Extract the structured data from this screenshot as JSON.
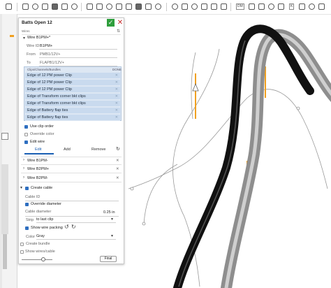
{
  "dialog": {
    "title": "Batts Open 12",
    "section_label": "Wires",
    "wire_group": "Wire B1PM+*",
    "wire_id_label": "Wire ID",
    "wire_id_value": "B1PM+",
    "from_label": "From",
    "from_value": "PMB1/12V+",
    "to_label": "To",
    "to_value": "FLAPB1/12V+",
    "clips_header": "Clips/Channels/Bundles",
    "clips_done": "DONE",
    "clips": [
      "Edge of 12 PM power Clip",
      "Edge of 12 PM power Clip",
      "Edge of 12 PM power Clip",
      "Edge of Transform corner bkt clips",
      "Edge of Transform corner bkt clips",
      "Edge of Battery flap ties",
      "Edge of Battery flap ties"
    ],
    "use_clip_order": "Use clip order",
    "override_color": "Override color",
    "edit_wire": "Edit wire",
    "tab_edit": "Edit",
    "tab_add": "Add",
    "tab_remove": "Remove",
    "collapsed_wires": [
      "Wire B1PM-",
      "Wire B2PM+",
      "Wire B2PM-"
    ],
    "create_cable": "Create cable",
    "cable_id_label": "Cable ID",
    "override_diameter": "Override diameter",
    "cable_diameter_label": "Cable diameter",
    "cable_diameter_value": "0.25 in",
    "strip_label": "Strip",
    "strip_value": "to last clip",
    "show_wire_packing": "Show wire packing",
    "color_label": "Color",
    "color_value": "Gray",
    "create_bundle": "Create bundle",
    "show_wires_cable": "Show wires/cable",
    "final_button": "Final"
  },
  "toolbar": {
    "tag_a": "DM",
    "tag_b": "K"
  },
  "colors": {
    "ok_green": "#2e9e3c",
    "close_red": "#c62828",
    "selection_blue": "#c9daee",
    "wire_orange": "#f0a020",
    "cable_black": "#111111",
    "cable_gray": "#9a9a9a"
  }
}
